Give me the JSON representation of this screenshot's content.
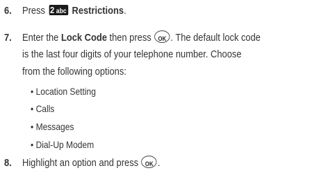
{
  "steps": [
    {
      "number": "6.",
      "press_text": "Press",
      "key_digit": "2",
      "key_letters": "abc",
      "menu_name": "Restrictions",
      "end_period": "."
    },
    {
      "number": "7.",
      "enter_text": "Enter the",
      "lock_code": "Lock Code",
      "then_press": "then press",
      "ok_label": "OK",
      "after_ok": ". The default lock code",
      "line2": "is the last four digits of your telephone number. Choose",
      "line3": "from the following options:",
      "options": [
        "Location Setting",
        "Calls",
        "Messages",
        "Dial-Up Modem"
      ]
    },
    {
      "number": "8.",
      "text": "Highlight an option and press",
      "ok_label": "OK",
      "end_period": "."
    }
  ]
}
